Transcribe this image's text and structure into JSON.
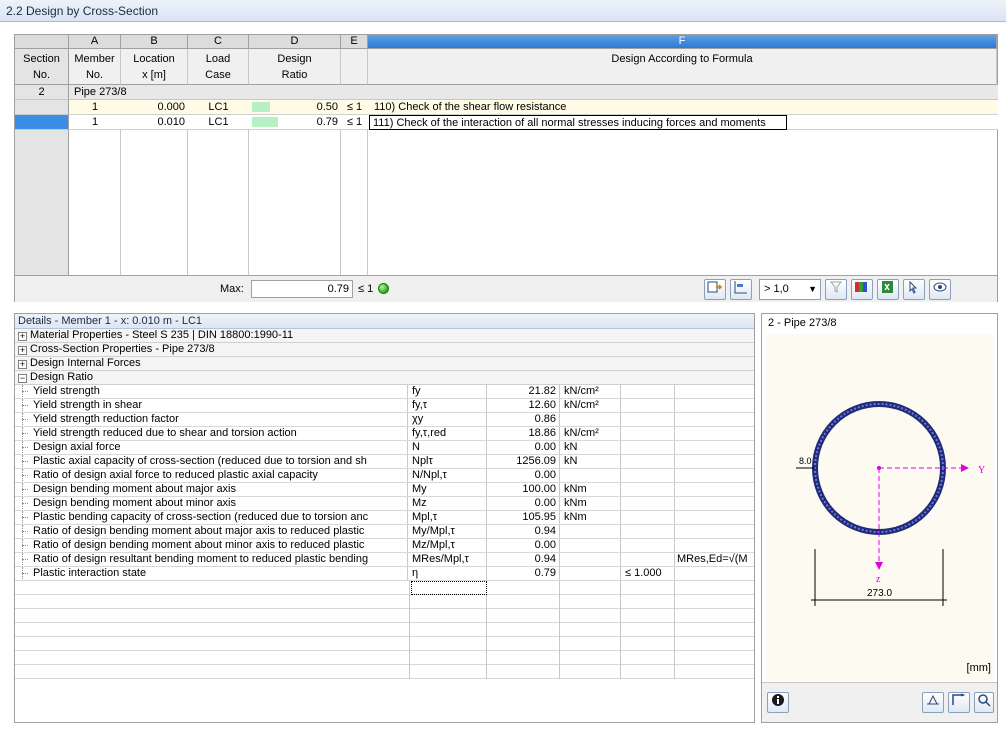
{
  "window": {
    "title": "2.2 Design by Cross-Section"
  },
  "table": {
    "columns": [
      {
        "letter": "",
        "lines": [
          "Section",
          "No."
        ]
      },
      {
        "letter": "A",
        "lines": [
          "Member",
          "No."
        ]
      },
      {
        "letter": "B",
        "lines": [
          "Location",
          "x [m]"
        ]
      },
      {
        "letter": "C",
        "lines": [
          "Load",
          "Case"
        ]
      },
      {
        "letter": "D",
        "lines": [
          "Design",
          "Ratio"
        ]
      },
      {
        "letter": "E",
        "lines": [
          "",
          ""
        ]
      },
      {
        "letter": "F",
        "lines": [
          "",
          "Design According to Formula"
        ]
      }
    ],
    "section": {
      "no": "2",
      "name": "Pipe 273/8"
    },
    "rows": [
      {
        "member": "1",
        "location": "0.000",
        "load_case": "LC1",
        "ratio": "0.50",
        "ratio_value": 0.5,
        "le": "≤ 1",
        "formula": "110) Check of the shear flow resistance"
      },
      {
        "member": "1",
        "location": "0.010",
        "load_case": "LC1",
        "ratio": "0.79",
        "ratio_value": 0.79,
        "le": "≤ 1",
        "formula": "111) Check of the interaction of all normal stresses inducing forces and moments"
      }
    ],
    "max_label": "Max:",
    "max_value": "0.79",
    "max_le": "≤ 1",
    "filter_combo": "> 1,0"
  },
  "details": {
    "title": "Details - Member 1 - x: 0.010 m - LC1",
    "groups": [
      {
        "sign": "+",
        "label": "Material Properties - Steel S 235 | DIN 18800:1990-11"
      },
      {
        "sign": "+",
        "label": "Cross-Section Properties  -  Pipe 273/8"
      },
      {
        "sign": "+",
        "label": "Design Internal Forces"
      },
      {
        "sign": "−",
        "label": "Design Ratio"
      }
    ],
    "rows": [
      {
        "desc": "Yield strength",
        "sym": "fy",
        "val": "21.82",
        "unit": "kN/cm²",
        "lim": "",
        "note": ""
      },
      {
        "desc": "Yield strength in shear",
        "sym": "fy,τ",
        "val": "12.60",
        "unit": "kN/cm²",
        "lim": "",
        "note": ""
      },
      {
        "desc": "Yield strength reduction factor",
        "sym": "χy",
        "val": "0.86",
        "unit": "",
        "lim": "",
        "note": ""
      },
      {
        "desc": "Yield strength reduced due to shear and torsion action",
        "sym": "fy,τ,red",
        "val": "18.86",
        "unit": "kN/cm²",
        "lim": "",
        "note": ""
      },
      {
        "desc": "Design axial force",
        "sym": "N",
        "val": "0.00",
        "unit": "kN",
        "lim": "",
        "note": ""
      },
      {
        "desc": "Plastic axial capacity of cross-section (reduced due to torsion and sh",
        "sym": "Nplτ",
        "val": "1256.09",
        "unit": "kN",
        "lim": "",
        "note": ""
      },
      {
        "desc": "Ratio of design axial force to reduced plastic axial capacity",
        "sym": "N/Npl,τ",
        "val": "0.00",
        "unit": "",
        "lim": "",
        "note": ""
      },
      {
        "desc": "Design bending moment about major axis",
        "sym": "My",
        "val": "100.00",
        "unit": "kNm",
        "lim": "",
        "note": ""
      },
      {
        "desc": "Design bending moment about minor axis",
        "sym": "Mz",
        "val": "0.00",
        "unit": "kNm",
        "lim": "",
        "note": ""
      },
      {
        "desc": "Plastic bending capacity of cross-section (reduced due to torsion anc",
        "sym": "Mpl,τ",
        "val": "105.95",
        "unit": "kNm",
        "lim": "",
        "note": ""
      },
      {
        "desc": "Ratio of design bending moment about major axis to reduced plastic",
        "sym": "My/Mpl,τ",
        "val": "0.94",
        "unit": "",
        "lim": "",
        "note": ""
      },
      {
        "desc": "Ratio of design bending moment about minor axis to reduced plastic",
        "sym": "Mz/Mpl,τ",
        "val": "0.00",
        "unit": "",
        "lim": "",
        "note": ""
      },
      {
        "desc": "Ratio of design resultant bending moment to reduced plastic bending",
        "sym": "MRes/Mpl,τ",
        "val": "0.94",
        "unit": "",
        "lim": "",
        "note": "MRes,Ed=√(M"
      },
      {
        "desc": "Plastic interaction state",
        "sym": "η",
        "val": "0.79",
        "unit": "",
        "lim": "≤ 1.000",
        "note": ""
      }
    ]
  },
  "graphic": {
    "title": "2 - Pipe 273/8",
    "thickness_label": "8.0",
    "y_axis": "Y",
    "z_axis": "z",
    "diameter_label": "273.0",
    "unit": "[mm]"
  },
  "colors": {
    "accent": "#2f7ad2",
    "ratio_bar": "#b7f0c2",
    "highlight_row": "#fffbe6",
    "axis": "#e000e0"
  }
}
